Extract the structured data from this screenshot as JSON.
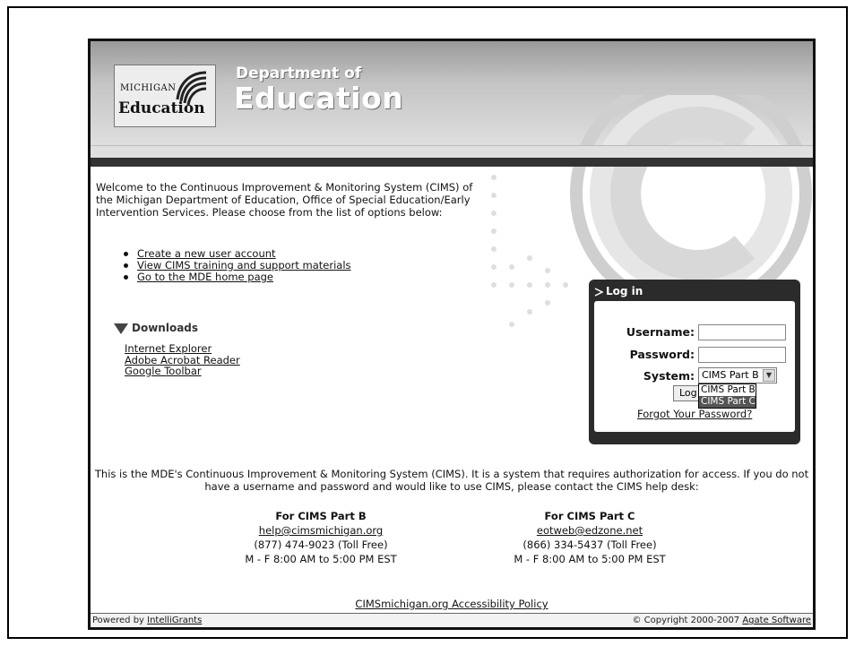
{
  "header": {
    "logo_state": "MICHIGAN",
    "logo_name": "Education",
    "title_small": "Department of",
    "title_large": "Education"
  },
  "intro": {
    "text": "Welcome to the Continuous Improvement & Monitoring System (CIMS) of the Michigan Department of Education, Office of Special Education/Early Intervention Services. Please choose from the list of options below:",
    "options": [
      {
        "label": "Create a new user account"
      },
      {
        "label": "View CIMS training and support materials"
      },
      {
        "label": "Go to the MDE home page"
      }
    ]
  },
  "downloads": {
    "heading": "Downloads",
    "items": [
      {
        "label": "Internet Explorer"
      },
      {
        "label": "Adobe Acrobat Reader"
      },
      {
        "label": "Google Toolbar"
      }
    ]
  },
  "login": {
    "title": "Log in",
    "username_label": "Username:",
    "username_value": "",
    "password_label": "Password:",
    "password_value": "",
    "system_label": "System:",
    "system_selected": "CIMS Part B",
    "system_options": [
      "CIMS Part B",
      "CIMS Part C"
    ],
    "system_highlighted": "CIMS Part C",
    "button_label": "Log",
    "forgot_label": "Forgot Your Password?"
  },
  "notice": {
    "text": "This is the MDE's Continuous Improvement & Monitoring System (CIMS). It is a system that requires authorization for access. If you do not have a username and password and would like to use CIMS, please contact the CIMS help desk:"
  },
  "contacts": {
    "part_b": {
      "heading": "For CIMS Part B",
      "email": "help@cimsmichigan.org",
      "phone": "(877) 474-9023 (Toll Free)",
      "hours": "M - F 8:00 AM to 5:00 PM EST"
    },
    "part_c": {
      "heading": "For CIMS Part C",
      "email": "eotweb@edzone.net",
      "phone": "(866) 334-5437 (Toll Free)",
      "hours": "M - F 8:00 AM to 5:00 PM EST"
    }
  },
  "policy_label": "CIMSmichigan.org Accessibility Policy",
  "footer": {
    "powered_prefix": "Powered by ",
    "powered_link": "IntelliGrants",
    "copyright_prefix": "© Copyright 2000-2007 ",
    "copyright_link": "Agate Software"
  }
}
